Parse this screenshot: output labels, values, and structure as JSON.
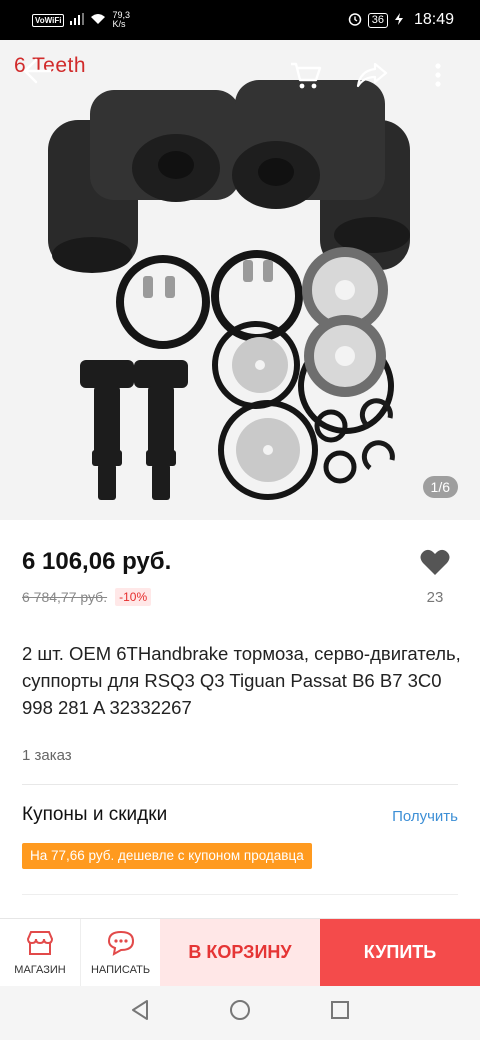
{
  "status_bar": {
    "wifi_label": "VoWiFi",
    "speed_value": "79,3",
    "speed_unit": "K/s",
    "battery": "36",
    "time": "18:49"
  },
  "gallery": {
    "brand_overlay": "6 Teeth",
    "page_indicator": "1/6",
    "icons": [
      "back-arrow-icon",
      "cart-icon",
      "share-icon",
      "more-vertical-icon"
    ]
  },
  "product": {
    "price": "6 106,06 руб.",
    "old_price": "6 784,77 руб.",
    "discount": "-10%",
    "wishlist_count": "23",
    "title": "2 шт. OEM 6THandbrake тормоза, серво-двигатель, суппорты для RSQ3 Q3 Tiguan Passat B6 B7 3C0 998 281 A 32332267",
    "orders": "1 заказ"
  },
  "coupons": {
    "title": "Купоны и скидки",
    "action": "Получить",
    "tag": "На 77,66 руб. дешевле с купоном продавца"
  },
  "action_bar": {
    "store_label": "МАГАЗИН",
    "message_label": "НАПИСАТЬ",
    "cart_label": "В КОРЗИНУ",
    "buy_label": "КУПИТЬ"
  },
  "colors": {
    "accent": "#f44b4b",
    "cart_bg": "#ffe7e7",
    "coupon_tag": "#ff9a1f",
    "link": "#3d8fd6",
    "brand": "#d12b2b"
  }
}
